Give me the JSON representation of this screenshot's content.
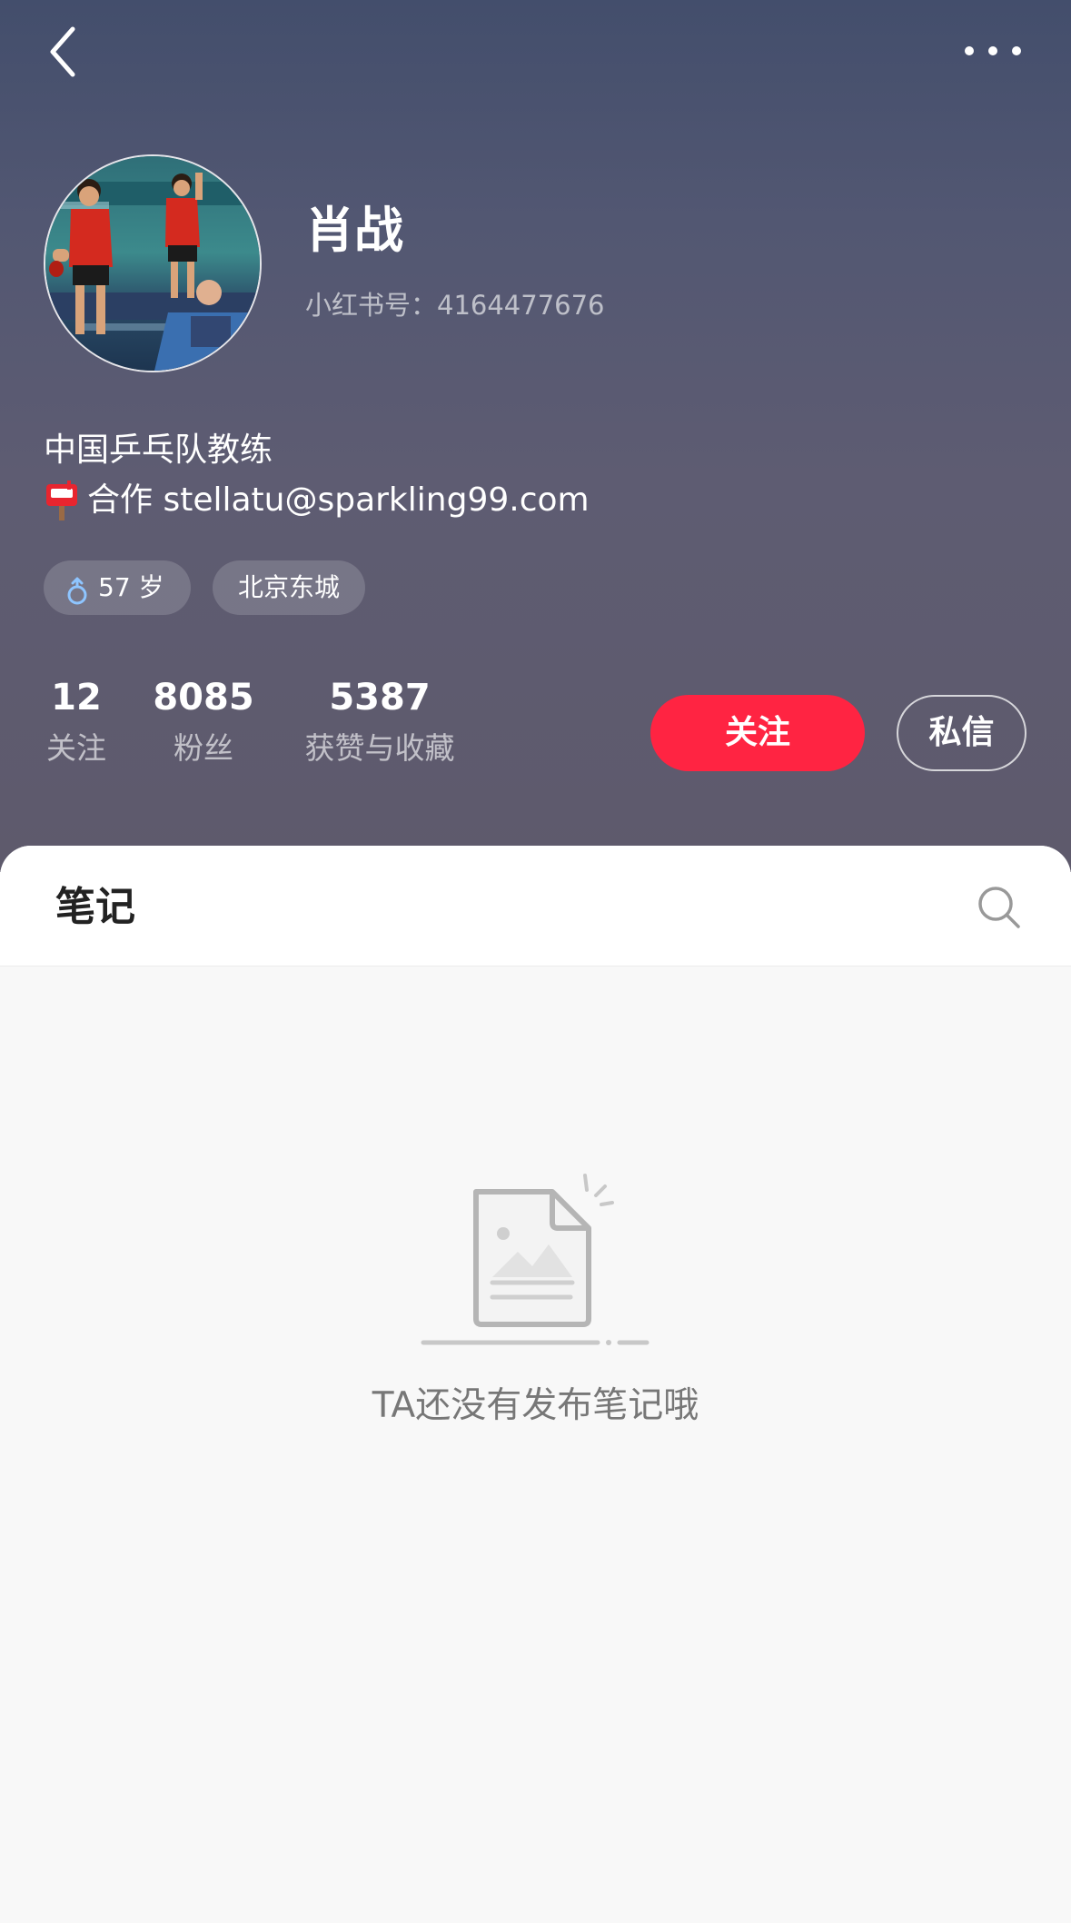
{
  "nav": {
    "back_icon": "chevron-left-icon",
    "more_icon": "more-dots-icon"
  },
  "profile": {
    "nickname": "肖战",
    "account_id": "小红书号：4164477676",
    "bio_line1": "中国乒乓队教练",
    "bio_line2": "合作 stellatu@sparkling99.com",
    "bio_icon": "mailbox-icon",
    "tags": {
      "age": "57 岁",
      "age_icon": "male-gender-icon",
      "location": "北京东城"
    },
    "stats": {
      "following_value": "12",
      "following_label": "关注",
      "fans_value": "8085",
      "fans_label": "粉丝",
      "likes_value": "5387",
      "likes_label": "获赞与收藏"
    },
    "actions": {
      "follow_label": "关注",
      "message_label": "私信"
    }
  },
  "content": {
    "tab_label": "笔记",
    "search_icon": "search-icon",
    "empty_text": "TA还没有发布笔记哦"
  },
  "colors": {
    "header_top": "#434e6c",
    "header_bottom": "#5e5a6c",
    "follow_button": "#ff2442",
    "panel_background": "#f8f8f8"
  }
}
